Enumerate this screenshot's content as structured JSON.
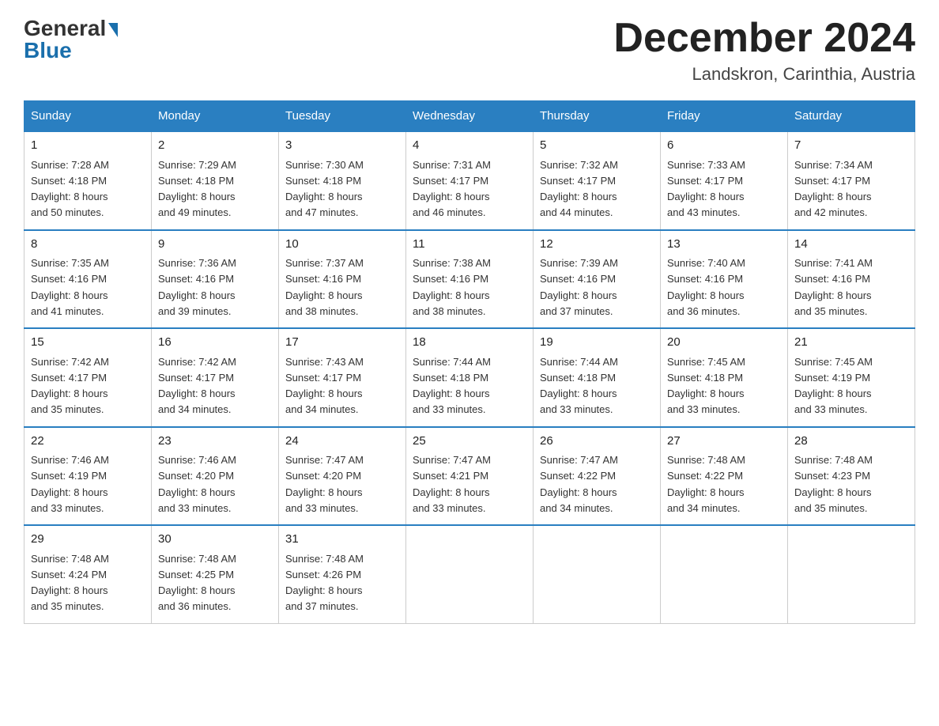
{
  "header": {
    "logo_general": "General",
    "logo_blue": "Blue",
    "calendar_title": "December 2024",
    "calendar_subtitle": "Landskron, Carinthia, Austria"
  },
  "weekdays": [
    "Sunday",
    "Monday",
    "Tuesday",
    "Wednesday",
    "Thursday",
    "Friday",
    "Saturday"
  ],
  "weeks": [
    [
      {
        "day": "1",
        "sunrise": "7:28 AM",
        "sunset": "4:18 PM",
        "daylight": "8 hours and 50 minutes."
      },
      {
        "day": "2",
        "sunrise": "7:29 AM",
        "sunset": "4:18 PM",
        "daylight": "8 hours and 49 minutes."
      },
      {
        "day": "3",
        "sunrise": "7:30 AM",
        "sunset": "4:18 PM",
        "daylight": "8 hours and 47 minutes."
      },
      {
        "day": "4",
        "sunrise": "7:31 AM",
        "sunset": "4:17 PM",
        "daylight": "8 hours and 46 minutes."
      },
      {
        "day": "5",
        "sunrise": "7:32 AM",
        "sunset": "4:17 PM",
        "daylight": "8 hours and 44 minutes."
      },
      {
        "day": "6",
        "sunrise": "7:33 AM",
        "sunset": "4:17 PM",
        "daylight": "8 hours and 43 minutes."
      },
      {
        "day": "7",
        "sunrise": "7:34 AM",
        "sunset": "4:17 PM",
        "daylight": "8 hours and 42 minutes."
      }
    ],
    [
      {
        "day": "8",
        "sunrise": "7:35 AM",
        "sunset": "4:16 PM",
        "daylight": "8 hours and 41 minutes."
      },
      {
        "day": "9",
        "sunrise": "7:36 AM",
        "sunset": "4:16 PM",
        "daylight": "8 hours and 39 minutes."
      },
      {
        "day": "10",
        "sunrise": "7:37 AM",
        "sunset": "4:16 PM",
        "daylight": "8 hours and 38 minutes."
      },
      {
        "day": "11",
        "sunrise": "7:38 AM",
        "sunset": "4:16 PM",
        "daylight": "8 hours and 38 minutes."
      },
      {
        "day": "12",
        "sunrise": "7:39 AM",
        "sunset": "4:16 PM",
        "daylight": "8 hours and 37 minutes."
      },
      {
        "day": "13",
        "sunrise": "7:40 AM",
        "sunset": "4:16 PM",
        "daylight": "8 hours and 36 minutes."
      },
      {
        "day": "14",
        "sunrise": "7:41 AM",
        "sunset": "4:16 PM",
        "daylight": "8 hours and 35 minutes."
      }
    ],
    [
      {
        "day": "15",
        "sunrise": "7:42 AM",
        "sunset": "4:17 PM",
        "daylight": "8 hours and 35 minutes."
      },
      {
        "day": "16",
        "sunrise": "7:42 AM",
        "sunset": "4:17 PM",
        "daylight": "8 hours and 34 minutes."
      },
      {
        "day": "17",
        "sunrise": "7:43 AM",
        "sunset": "4:17 PM",
        "daylight": "8 hours and 34 minutes."
      },
      {
        "day": "18",
        "sunrise": "7:44 AM",
        "sunset": "4:18 PM",
        "daylight": "8 hours and 33 minutes."
      },
      {
        "day": "19",
        "sunrise": "7:44 AM",
        "sunset": "4:18 PM",
        "daylight": "8 hours and 33 minutes."
      },
      {
        "day": "20",
        "sunrise": "7:45 AM",
        "sunset": "4:18 PM",
        "daylight": "8 hours and 33 minutes."
      },
      {
        "day": "21",
        "sunrise": "7:45 AM",
        "sunset": "4:19 PM",
        "daylight": "8 hours and 33 minutes."
      }
    ],
    [
      {
        "day": "22",
        "sunrise": "7:46 AM",
        "sunset": "4:19 PM",
        "daylight": "8 hours and 33 minutes."
      },
      {
        "day": "23",
        "sunrise": "7:46 AM",
        "sunset": "4:20 PM",
        "daylight": "8 hours and 33 minutes."
      },
      {
        "day": "24",
        "sunrise": "7:47 AM",
        "sunset": "4:20 PM",
        "daylight": "8 hours and 33 minutes."
      },
      {
        "day": "25",
        "sunrise": "7:47 AM",
        "sunset": "4:21 PM",
        "daylight": "8 hours and 33 minutes."
      },
      {
        "day": "26",
        "sunrise": "7:47 AM",
        "sunset": "4:22 PM",
        "daylight": "8 hours and 34 minutes."
      },
      {
        "day": "27",
        "sunrise": "7:48 AM",
        "sunset": "4:22 PM",
        "daylight": "8 hours and 34 minutes."
      },
      {
        "day": "28",
        "sunrise": "7:48 AM",
        "sunset": "4:23 PM",
        "daylight": "8 hours and 35 minutes."
      }
    ],
    [
      {
        "day": "29",
        "sunrise": "7:48 AM",
        "sunset": "4:24 PM",
        "daylight": "8 hours and 35 minutes."
      },
      {
        "day": "30",
        "sunrise": "7:48 AM",
        "sunset": "4:25 PM",
        "daylight": "8 hours and 36 minutes."
      },
      {
        "day": "31",
        "sunrise": "7:48 AM",
        "sunset": "4:26 PM",
        "daylight": "8 hours and 37 minutes."
      },
      null,
      null,
      null,
      null
    ]
  ],
  "labels": {
    "sunrise": "Sunrise:",
    "sunset": "Sunset:",
    "daylight": "Daylight:"
  }
}
